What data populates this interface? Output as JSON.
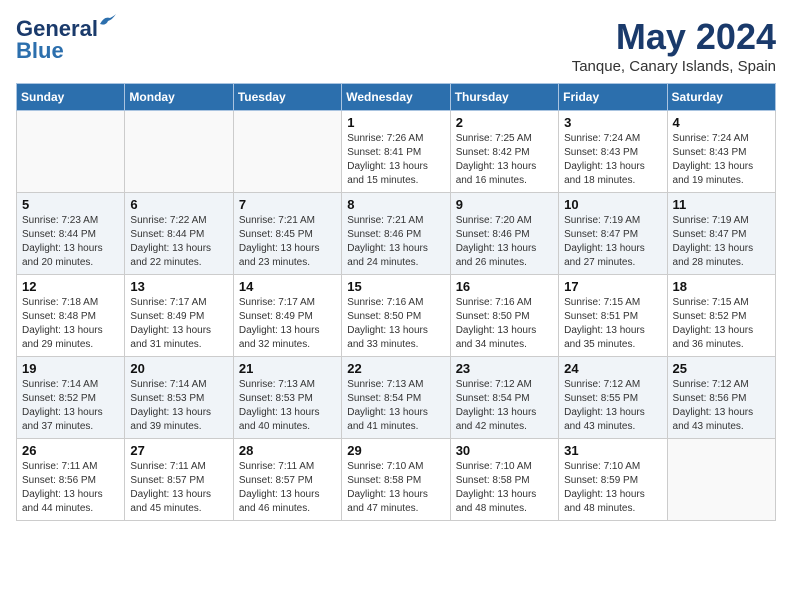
{
  "header": {
    "logo_line1": "General",
    "logo_line2": "Blue",
    "month": "May 2024",
    "location": "Tanque, Canary Islands, Spain"
  },
  "weekdays": [
    "Sunday",
    "Monday",
    "Tuesday",
    "Wednesday",
    "Thursday",
    "Friday",
    "Saturday"
  ],
  "weeks": [
    [
      {
        "day": "",
        "info": ""
      },
      {
        "day": "",
        "info": ""
      },
      {
        "day": "",
        "info": ""
      },
      {
        "day": "1",
        "info": "Sunrise: 7:26 AM\nSunset: 8:41 PM\nDaylight: 13 hours\nand 15 minutes."
      },
      {
        "day": "2",
        "info": "Sunrise: 7:25 AM\nSunset: 8:42 PM\nDaylight: 13 hours\nand 16 minutes."
      },
      {
        "day": "3",
        "info": "Sunrise: 7:24 AM\nSunset: 8:43 PM\nDaylight: 13 hours\nand 18 minutes."
      },
      {
        "day": "4",
        "info": "Sunrise: 7:24 AM\nSunset: 8:43 PM\nDaylight: 13 hours\nand 19 minutes."
      }
    ],
    [
      {
        "day": "5",
        "info": "Sunrise: 7:23 AM\nSunset: 8:44 PM\nDaylight: 13 hours\nand 20 minutes."
      },
      {
        "day": "6",
        "info": "Sunrise: 7:22 AM\nSunset: 8:44 PM\nDaylight: 13 hours\nand 22 minutes."
      },
      {
        "day": "7",
        "info": "Sunrise: 7:21 AM\nSunset: 8:45 PM\nDaylight: 13 hours\nand 23 minutes."
      },
      {
        "day": "8",
        "info": "Sunrise: 7:21 AM\nSunset: 8:46 PM\nDaylight: 13 hours\nand 24 minutes."
      },
      {
        "day": "9",
        "info": "Sunrise: 7:20 AM\nSunset: 8:46 PM\nDaylight: 13 hours\nand 26 minutes."
      },
      {
        "day": "10",
        "info": "Sunrise: 7:19 AM\nSunset: 8:47 PM\nDaylight: 13 hours\nand 27 minutes."
      },
      {
        "day": "11",
        "info": "Sunrise: 7:19 AM\nSunset: 8:47 PM\nDaylight: 13 hours\nand 28 minutes."
      }
    ],
    [
      {
        "day": "12",
        "info": "Sunrise: 7:18 AM\nSunset: 8:48 PM\nDaylight: 13 hours\nand 29 minutes."
      },
      {
        "day": "13",
        "info": "Sunrise: 7:17 AM\nSunset: 8:49 PM\nDaylight: 13 hours\nand 31 minutes."
      },
      {
        "day": "14",
        "info": "Sunrise: 7:17 AM\nSunset: 8:49 PM\nDaylight: 13 hours\nand 32 minutes."
      },
      {
        "day": "15",
        "info": "Sunrise: 7:16 AM\nSunset: 8:50 PM\nDaylight: 13 hours\nand 33 minutes."
      },
      {
        "day": "16",
        "info": "Sunrise: 7:16 AM\nSunset: 8:50 PM\nDaylight: 13 hours\nand 34 minutes."
      },
      {
        "day": "17",
        "info": "Sunrise: 7:15 AM\nSunset: 8:51 PM\nDaylight: 13 hours\nand 35 minutes."
      },
      {
        "day": "18",
        "info": "Sunrise: 7:15 AM\nSunset: 8:52 PM\nDaylight: 13 hours\nand 36 minutes."
      }
    ],
    [
      {
        "day": "19",
        "info": "Sunrise: 7:14 AM\nSunset: 8:52 PM\nDaylight: 13 hours\nand 37 minutes."
      },
      {
        "day": "20",
        "info": "Sunrise: 7:14 AM\nSunset: 8:53 PM\nDaylight: 13 hours\nand 39 minutes."
      },
      {
        "day": "21",
        "info": "Sunrise: 7:13 AM\nSunset: 8:53 PM\nDaylight: 13 hours\nand 40 minutes."
      },
      {
        "day": "22",
        "info": "Sunrise: 7:13 AM\nSunset: 8:54 PM\nDaylight: 13 hours\nand 41 minutes."
      },
      {
        "day": "23",
        "info": "Sunrise: 7:12 AM\nSunset: 8:54 PM\nDaylight: 13 hours\nand 42 minutes."
      },
      {
        "day": "24",
        "info": "Sunrise: 7:12 AM\nSunset: 8:55 PM\nDaylight: 13 hours\nand 43 minutes."
      },
      {
        "day": "25",
        "info": "Sunrise: 7:12 AM\nSunset: 8:56 PM\nDaylight: 13 hours\nand 43 minutes."
      }
    ],
    [
      {
        "day": "26",
        "info": "Sunrise: 7:11 AM\nSunset: 8:56 PM\nDaylight: 13 hours\nand 44 minutes."
      },
      {
        "day": "27",
        "info": "Sunrise: 7:11 AM\nSunset: 8:57 PM\nDaylight: 13 hours\nand 45 minutes."
      },
      {
        "day": "28",
        "info": "Sunrise: 7:11 AM\nSunset: 8:57 PM\nDaylight: 13 hours\nand 46 minutes."
      },
      {
        "day": "29",
        "info": "Sunrise: 7:10 AM\nSunset: 8:58 PM\nDaylight: 13 hours\nand 47 minutes."
      },
      {
        "day": "30",
        "info": "Sunrise: 7:10 AM\nSunset: 8:58 PM\nDaylight: 13 hours\nand 48 minutes."
      },
      {
        "day": "31",
        "info": "Sunrise: 7:10 AM\nSunset: 8:59 PM\nDaylight: 13 hours\nand 48 minutes."
      },
      {
        "day": "",
        "info": ""
      }
    ]
  ]
}
